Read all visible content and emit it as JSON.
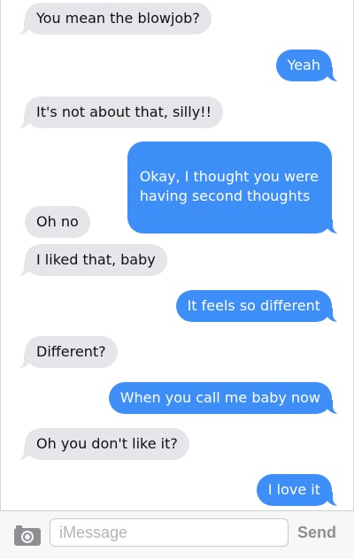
{
  "conversation": {
    "messages": [
      {
        "direction": "incoming",
        "text": "You mean the blowjob?"
      },
      {
        "direction": "outgoing",
        "text": "Yeah"
      },
      {
        "direction": "incoming",
        "text": "It's not about that, silly!!"
      },
      {
        "direction": "outgoing",
        "text": "Okay, I thought you were\nhaving second thoughts"
      },
      {
        "direction": "incoming",
        "text": "Oh no"
      },
      {
        "direction": "incoming",
        "text": "I liked that, baby"
      },
      {
        "direction": "outgoing",
        "text": "It feels so different"
      },
      {
        "direction": "incoming",
        "text": "Different?"
      },
      {
        "direction": "outgoing",
        "text": "When you call me baby now"
      },
      {
        "direction": "incoming",
        "text": "Oh you don't like it?"
      },
      {
        "direction": "outgoing",
        "text": "I love it"
      }
    ]
  },
  "composer": {
    "placeholder": "iMessage",
    "send_label": "Send",
    "camera_icon": "camera-icon"
  },
  "colors": {
    "incoming_bubble": "#e5e5ea",
    "outgoing_bubble": "#3d8ef7",
    "send_disabled": "#8e8e93"
  }
}
